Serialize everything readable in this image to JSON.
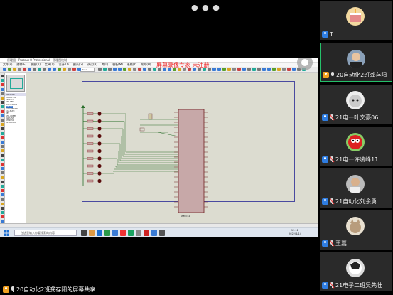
{
  "window": {
    "title": "原理图 - Proteus 8 Professional - 原理图绘制",
    "menus": [
      "文件(F)",
      "编辑(E)",
      "视图(V)",
      "工具(T)",
      "设计(D)",
      "图表(G)",
      "调试(B)",
      "库(L)",
      "模板(M)",
      "系统(Y)",
      "帮助(H)"
    ],
    "design_dropdown": "Base Design",
    "watermark": "屏幕录像专家 未注册"
  },
  "panel": {
    "header": "DEVICES",
    "devices": [
      "CAPACITOR",
      "CRYSTAL",
      "LED-RED",
      "LED-YELLOW",
      "LM016L",
      "LOGICPROBE",
      "CAP-ELEC",
      "RES",
      "LED-GREEN",
      "SW-SPST",
      "AT89C51",
      "RESPACK-8"
    ],
    "selected_index": 4
  },
  "schematic": {
    "chip_label": "AT89C51",
    "led_count": 10
  },
  "taskbar": {
    "search_placeholder": "在这里输入你要搜索的内容",
    "time": "19:12",
    "date": "2022/4/14"
  },
  "participants": [
    {
      "name": "T",
      "avatar": "cake",
      "icon": "user",
      "mic": "none"
    },
    {
      "name": "20自动化2班龚存阳",
      "avatar": "person",
      "icon": "host",
      "mic": "on",
      "active": true
    },
    {
      "name": "21电一叶文豪06",
      "avatar": "cat",
      "icon": "user",
      "mic": "muted"
    },
    {
      "name": "21电一许凌峰11",
      "avatar": "bird",
      "icon": "user",
      "mic": "muted"
    },
    {
      "name": "21自动化刘余勇",
      "avatar": "person2",
      "icon": "user",
      "mic": "muted"
    },
    {
      "name": "王嵩",
      "avatar": "cat2",
      "icon": "user",
      "mic": "muted"
    },
    {
      "name": "21电子二班吴先壮",
      "avatar": "anime",
      "icon": "user",
      "mic": "muted"
    }
  ],
  "share_status": "20自动化2班龚存阳的屏幕共享",
  "colors": {
    "active_border": "#25c06a",
    "watermark": "#e22222"
  }
}
